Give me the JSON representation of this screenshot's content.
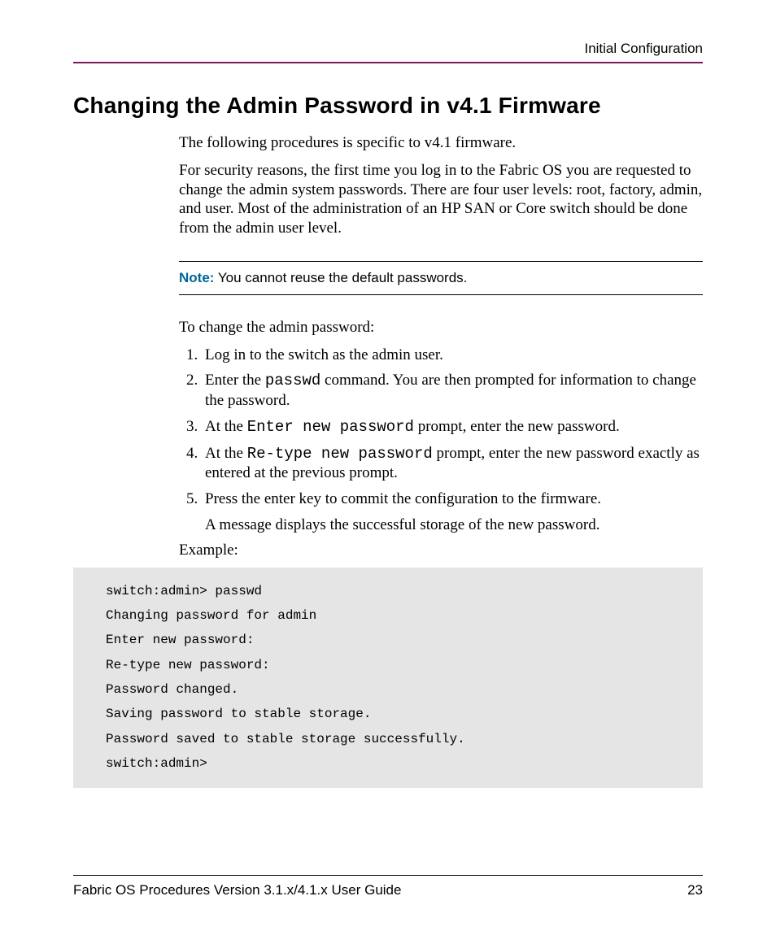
{
  "header": {
    "section": "Initial Configuration"
  },
  "heading": "Changing the Admin Password in v4.1 Firmware",
  "intro": {
    "p1": "The following procedures is specific to v4.1 firmware.",
    "p2": "For security reasons, the first time you log in to the Fabric OS you are requested to change the admin system passwords. There are four user levels: root, factory, admin, and user. Most of the administration of an HP SAN or Core switch should be done from the admin user level."
  },
  "note": {
    "label": "Note:",
    "text": "  You cannot reuse the default passwords."
  },
  "lead": "To change the admin password:",
  "steps": {
    "s1": "Log in to the switch as the admin user.",
    "s2a": "Enter the ",
    "s2cmd": "passwd",
    "s2b": " command. You are then prompted for information to change the password.",
    "s3a": "At the ",
    "s3cmd": "Enter new password",
    "s3b": " prompt, enter the new password.",
    "s4a": "At the ",
    "s4cmd": "Re-type new password",
    "s4b": " prompt, enter the new password exactly as entered at the previous prompt.",
    "s5": "Press the enter key to commit the configuration to the firmware.",
    "s5_follow": "A message displays the successful storage of the new password."
  },
  "example_label": "Example:",
  "code": "switch:admin> passwd\nChanging password for admin\nEnter new password:\nRe-type new password:\nPassword changed.\nSaving password to stable storage.\nPassword saved to stable storage successfully.\nswitch:admin>",
  "footer": {
    "title": "Fabric OS Procedures Version 3.1.x/4.1.x User Guide",
    "page": "23"
  }
}
